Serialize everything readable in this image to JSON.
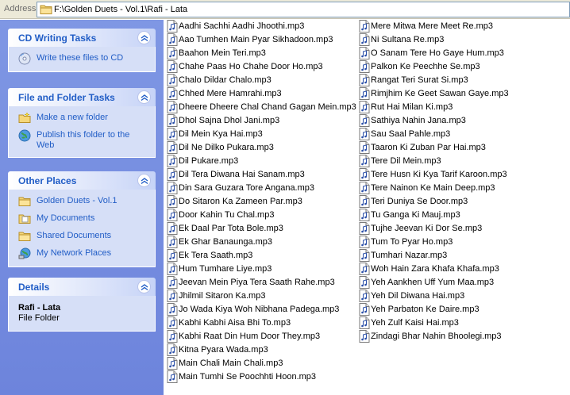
{
  "address": {
    "label": "Address",
    "path": "F:\\Golden Duets - Vol.1\\Rafi - Lata"
  },
  "taskpane": {
    "cd_writing": {
      "title": "CD Writing Tasks",
      "tasks": [
        "Write these files to CD"
      ]
    },
    "file_folder": {
      "title": "File and Folder Tasks",
      "tasks": [
        "Make a new folder",
        "Publish this folder to the Web"
      ]
    },
    "other_places": {
      "title": "Other Places",
      "places": [
        "Golden Duets - Vol.1",
        "My Documents",
        "Shared Documents",
        "My Network Places"
      ]
    },
    "details": {
      "title": "Details",
      "name": "Rafi - Lata",
      "type": "File Folder"
    }
  },
  "files_col1": [
    "Aadhi Sachhi Aadhi Jhoothi.mp3",
    "Aao Tumhen Main Pyar Sikhadoon.mp3",
    "Baahon Mein Teri.mp3",
    "Chahe Paas Ho Chahe Door Ho.mp3",
    "Chalo Dildar Chalo.mp3",
    "Chhed Mere Hamrahi.mp3",
    "Dheere Dheere Chal Chand Gagan Mein.mp3",
    "Dhol Sajna Dhol Jani.mp3",
    "Dil Mein Kya Hai.mp3",
    "Dil Ne Dilko Pukara.mp3",
    "Dil Pukare.mp3",
    "Dil Tera Diwana Hai Sanam.mp3",
    "Din Sara Guzara Tore Angana.mp3",
    "Do Sitaron Ka Zameen Par.mp3",
    "Door Kahin Tu Chal.mp3",
    "Ek Daal Par Tota Bole.mp3",
    "Ek Ghar Banaunga.mp3",
    "Ek Tera Saath.mp3",
    "Hum Tumhare Liye.mp3",
    "Jeevan Mein Piya Tera Saath Rahe.mp3",
    "Jhilmil Sitaron Ka.mp3",
    "Jo Wada Kiya Woh Nibhana Padega.mp3",
    "Kabhi Kabhi Aisa Bhi To.mp3",
    "Kabhi Raat Din Hum Door They.mp3",
    "Kitna Pyara Wada.mp3",
    "Main Chali Main Chali.mp3",
    "Main Tumhi Se Poochhti Hoon.mp3"
  ],
  "files_col2": [
    "Mere Mitwa Mere Meet Re.mp3",
    "Ni Sultana Re.mp3",
    "O Sanam Tere Ho Gaye Hum.mp3",
    "Palkon Ke Peechhe Se.mp3",
    "Rangat Teri Surat Si.mp3",
    "Rimjhim Ke Geet Sawan Gaye.mp3",
    "Rut Hai Milan Ki.mp3",
    "Sathiya Nahin Jana.mp3",
    "Sau Saal Pahle.mp3",
    "Taaron Ki Zuban Par Hai.mp3",
    "Tere Dil Mein.mp3",
    "Tere Husn Ki Kya Tarif Karoon.mp3",
    "Tere Nainon Ke Main Deep.mp3",
    "Teri Duniya Se Door.mp3",
    "Tu Ganga Ki Mauj.mp3",
    "Tujhe Jeevan Ki Dor Se.mp3",
    "Tum To Pyar Ho.mp3",
    "Tumhari Nazar.mp3",
    "Woh Hain Zara Khafa Khafa.mp3",
    "Yeh Aankhen Uff Yum Maa.mp3",
    "Yeh Dil Diwana Hai.mp3",
    "Yeh Parbaton Ke Daire.mp3",
    "Yeh Zulf Kaisi Hai.mp3",
    "Zindagi Bhar Nahin Bhoolegi.mp3"
  ]
}
